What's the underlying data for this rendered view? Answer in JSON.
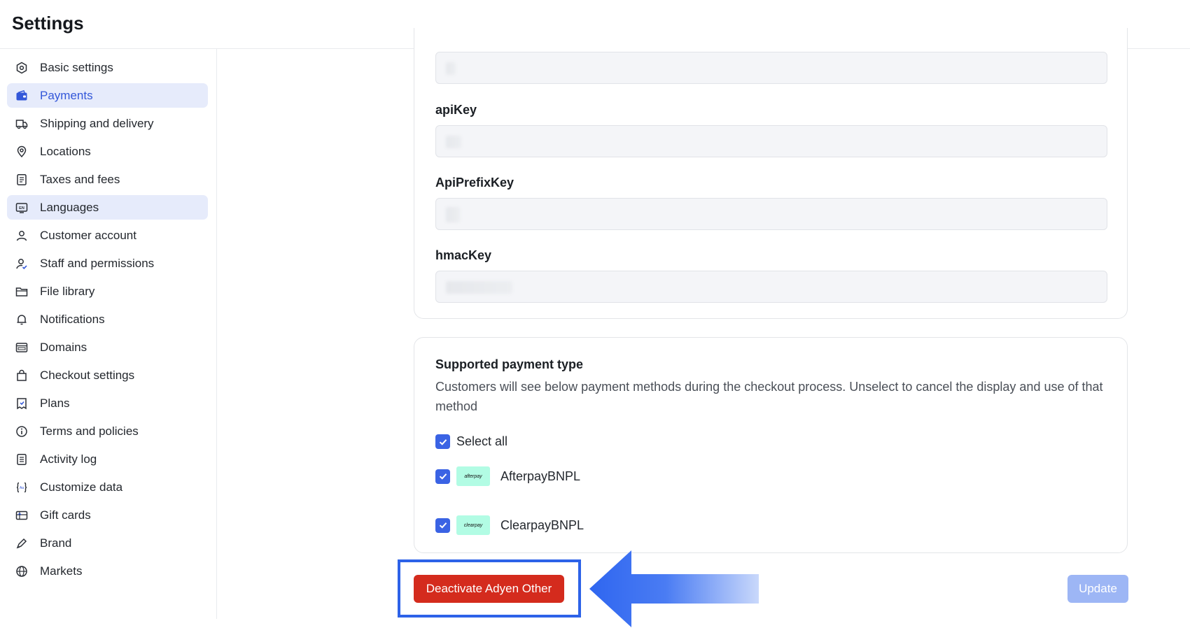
{
  "header": {
    "title": "Settings"
  },
  "sidebar": {
    "items": [
      {
        "label": "Basic settings",
        "icon": "settings-hex-icon"
      },
      {
        "label": "Payments",
        "icon": "wallet-icon"
      },
      {
        "label": "Shipping and delivery",
        "icon": "truck-icon"
      },
      {
        "label": "Locations",
        "icon": "location-pin-icon"
      },
      {
        "label": "Taxes and fees",
        "icon": "receipt-icon"
      },
      {
        "label": "Languages",
        "icon": "language-icon"
      },
      {
        "label": "Customer account",
        "icon": "user-icon"
      },
      {
        "label": "Staff and permissions",
        "icon": "user-check-icon"
      },
      {
        "label": "File library",
        "icon": "folder-icon"
      },
      {
        "label": "Notifications",
        "icon": "bell-icon"
      },
      {
        "label": "Domains",
        "icon": "browser-icon"
      },
      {
        "label": "Checkout settings",
        "icon": "shopping-bag-icon"
      },
      {
        "label": "Plans",
        "icon": "plan-icon"
      },
      {
        "label": "Terms and policies",
        "icon": "info-icon"
      },
      {
        "label": "Activity log",
        "icon": "log-icon"
      },
      {
        "label": "Customize data",
        "icon": "code-braces-icon"
      },
      {
        "label": "Gift cards",
        "icon": "gift-card-icon"
      },
      {
        "label": "Brand",
        "icon": "brand-icon"
      },
      {
        "label": "Markets",
        "icon": "globe-icon"
      }
    ]
  },
  "credentials": {
    "fields": [
      {
        "label": "apiKey",
        "value": ""
      },
      {
        "label": "ApiPrefixKey",
        "value": ""
      },
      {
        "label": "hmacKey",
        "value": ""
      }
    ]
  },
  "payment_types": {
    "title": "Supported payment type",
    "description": "Customers will see below payment methods during the checkout process. Unselect to cancel the display and use of that method",
    "select_all_label": "Select all",
    "methods": [
      {
        "label": "AfterpayBNPL",
        "logo_text": "afterpay",
        "checked": true
      },
      {
        "label": "ClearpayBNPL",
        "logo_text": "clearpay",
        "checked": true
      }
    ]
  },
  "actions": {
    "deactivate_label": "Deactivate Adyen Other",
    "update_label": "Update"
  },
  "colors": {
    "accent": "#3a63e4",
    "danger": "#d42b1d",
    "update_disabled": "#9db6f5",
    "highlight": "#2d62e8",
    "pm_logo_bg": "#b2fce4"
  }
}
